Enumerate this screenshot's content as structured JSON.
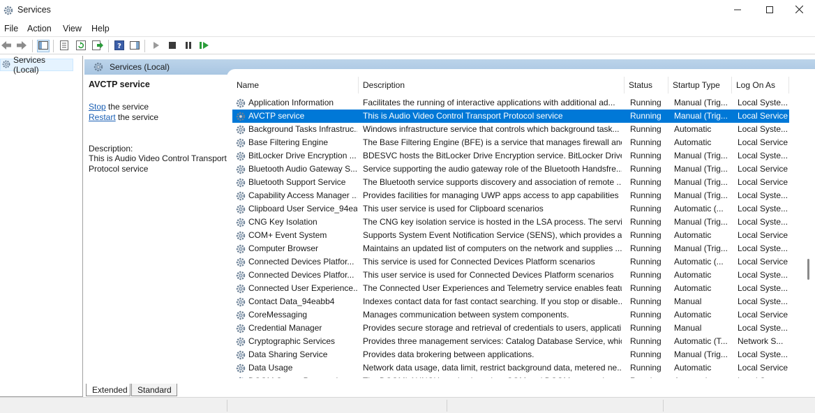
{
  "window": {
    "title": "Services"
  },
  "menu": [
    "File",
    "Action",
    "View",
    "Help"
  ],
  "tree": {
    "selected_item": "Services (Local)"
  },
  "pane": {
    "header_title": "Services (Local)"
  },
  "detail": {
    "service_title": "AVCTP service",
    "stop_link": "Stop",
    "stop_suffix": " the service",
    "restart_link": "Restart",
    "restart_suffix": " the service",
    "description_label": "Description:",
    "description_text": "This is Audio Video Control Transport Protocol service"
  },
  "table": {
    "columns": {
      "name": "Name",
      "description": "Description",
      "status": "Status",
      "startup_type": "Startup Type",
      "log_on_as": "Log On As"
    },
    "selected_row_index": 1,
    "rows": [
      {
        "name": "Application Information",
        "description": "Facilitates the running of interactive applications with additional ad...",
        "status": "Running",
        "startup": "Manual (Trig...",
        "logon": "Local Syste..."
      },
      {
        "name": "AVCTP service",
        "description": "This is Audio Video Control Transport Protocol service",
        "status": "Running",
        "startup": "Manual (Trig...",
        "logon": "Local Service"
      },
      {
        "name": "Background Tasks Infrastruc...",
        "description": "Windows infrastructure service that controls which background task...",
        "status": "Running",
        "startup": "Automatic",
        "logon": "Local Syste..."
      },
      {
        "name": "Base Filtering Engine",
        "description": "The Base Filtering Engine (BFE) is a service that manages firewall and ...",
        "status": "Running",
        "startup": "Automatic",
        "logon": "Local Service"
      },
      {
        "name": "BitLocker Drive Encryption ...",
        "description": "BDESVC hosts the BitLocker Drive Encryption service. BitLocker Drive ...",
        "status": "Running",
        "startup": "Manual (Trig...",
        "logon": "Local Syste..."
      },
      {
        "name": "Bluetooth Audio Gateway S...",
        "description": "Service supporting the audio gateway role of the Bluetooth Handsfre...",
        "status": "Running",
        "startup": "Manual (Trig...",
        "logon": "Local Service"
      },
      {
        "name": "Bluetooth Support Service",
        "description": "The Bluetooth service supports discovery and association of remote ...",
        "status": "Running",
        "startup": "Manual (Trig...",
        "logon": "Local Service"
      },
      {
        "name": "Capability Access Manager ...",
        "description": "Provides facilities for managing UWP apps access to app capabilities ...",
        "status": "Running",
        "startup": "Manual (Trig...",
        "logon": "Local Syste..."
      },
      {
        "name": "Clipboard User Service_94ea...",
        "description": "This user service is used for Clipboard scenarios",
        "status": "Running",
        "startup": "Automatic (...",
        "logon": "Local Syste..."
      },
      {
        "name": "CNG Key Isolation",
        "description": "The CNG key isolation service is hosted in the LSA process. The servic...",
        "status": "Running",
        "startup": "Manual (Trig...",
        "logon": "Local Syste..."
      },
      {
        "name": "COM+ Event System",
        "description": "Supports System Event Notification Service (SENS), which provides a...",
        "status": "Running",
        "startup": "Automatic",
        "logon": "Local Service"
      },
      {
        "name": "Computer Browser",
        "description": "Maintains an updated list of computers on the network and supplies ...",
        "status": "Running",
        "startup": "Manual (Trig...",
        "logon": "Local Syste..."
      },
      {
        "name": "Connected Devices Platfor...",
        "description": "This service is used for Connected Devices Platform scenarios",
        "status": "Running",
        "startup": "Automatic (...",
        "logon": "Local Service"
      },
      {
        "name": "Connected Devices Platfor...",
        "description": "This user service is used for Connected Devices Platform scenarios",
        "status": "Running",
        "startup": "Automatic",
        "logon": "Local Syste..."
      },
      {
        "name": "Connected User Experience...",
        "description": "The Connected User Experiences and Telemetry service enables featu...",
        "status": "Running",
        "startup": "Automatic",
        "logon": "Local Syste..."
      },
      {
        "name": "Contact Data_94eabb4",
        "description": "Indexes contact data for fast contact searching. If you stop or disable...",
        "status": "Running",
        "startup": "Manual",
        "logon": "Local Syste..."
      },
      {
        "name": "CoreMessaging",
        "description": "Manages communication between system components.",
        "status": "Running",
        "startup": "Automatic",
        "logon": "Local Service"
      },
      {
        "name": "Credential Manager",
        "description": "Provides secure storage and retrieval of credentials to users, applicati...",
        "status": "Running",
        "startup": "Manual",
        "logon": "Local Syste..."
      },
      {
        "name": "Cryptographic Services",
        "description": "Provides three management services: Catalog Database Service, whic...",
        "status": "Running",
        "startup": "Automatic (T...",
        "logon": "Network S..."
      },
      {
        "name": "Data Sharing Service",
        "description": "Provides data brokering between applications.",
        "status": "Running",
        "startup": "Manual (Trig...",
        "logon": "Local Syste..."
      },
      {
        "name": "Data Usage",
        "description": "Network data usage, data limit, restrict background data, metered ne...",
        "status": "Running",
        "startup": "Automatic",
        "logon": "Local Service"
      },
      {
        "name": "DCOM Server Process Laun...",
        "description": "The DCOMLAUNCH service launches COM and DCOM servers in res...",
        "status": "Running",
        "startup": "Automatic",
        "logon": "Local Syste..."
      }
    ]
  },
  "tabs": [
    "Extended",
    "Standard"
  ],
  "colors": {
    "selection": "#0078d7",
    "header_band": "#a9c6e2",
    "link": "#1a5fb4"
  }
}
